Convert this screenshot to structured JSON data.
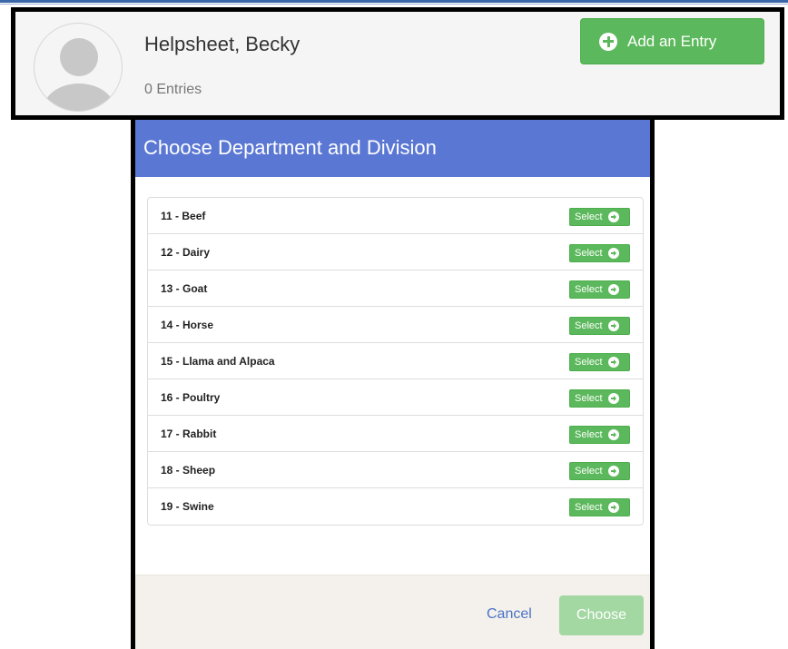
{
  "header": {
    "name": "Helpsheet, Becky",
    "entries": "0 Entries",
    "add_button_label": "Add an Entry"
  },
  "modal": {
    "title": "Choose Department and Division",
    "select_label": "Select",
    "items": [
      {
        "label": "11 - Beef"
      },
      {
        "label": "12 - Dairy"
      },
      {
        "label": "13 - Goat"
      },
      {
        "label": "14 - Horse"
      },
      {
        "label": "15 - Llama and Alpaca"
      },
      {
        "label": "16 - Poultry"
      },
      {
        "label": "17 - Rabbit"
      },
      {
        "label": "18 - Sheep"
      },
      {
        "label": "19 - Swine"
      }
    ],
    "cancel_label": "Cancel",
    "choose_label": "Choose"
  },
  "colors": {
    "modal_header": "#5a77d4",
    "success_green": "#5cb85c",
    "choose_disabled": "#a3d8a3",
    "link_blue": "#4a72c8"
  },
  "icons": {
    "add": "plus-circle-icon",
    "select": "arrow-circle-right-icon",
    "avatar": "user-silhouette-icon"
  }
}
